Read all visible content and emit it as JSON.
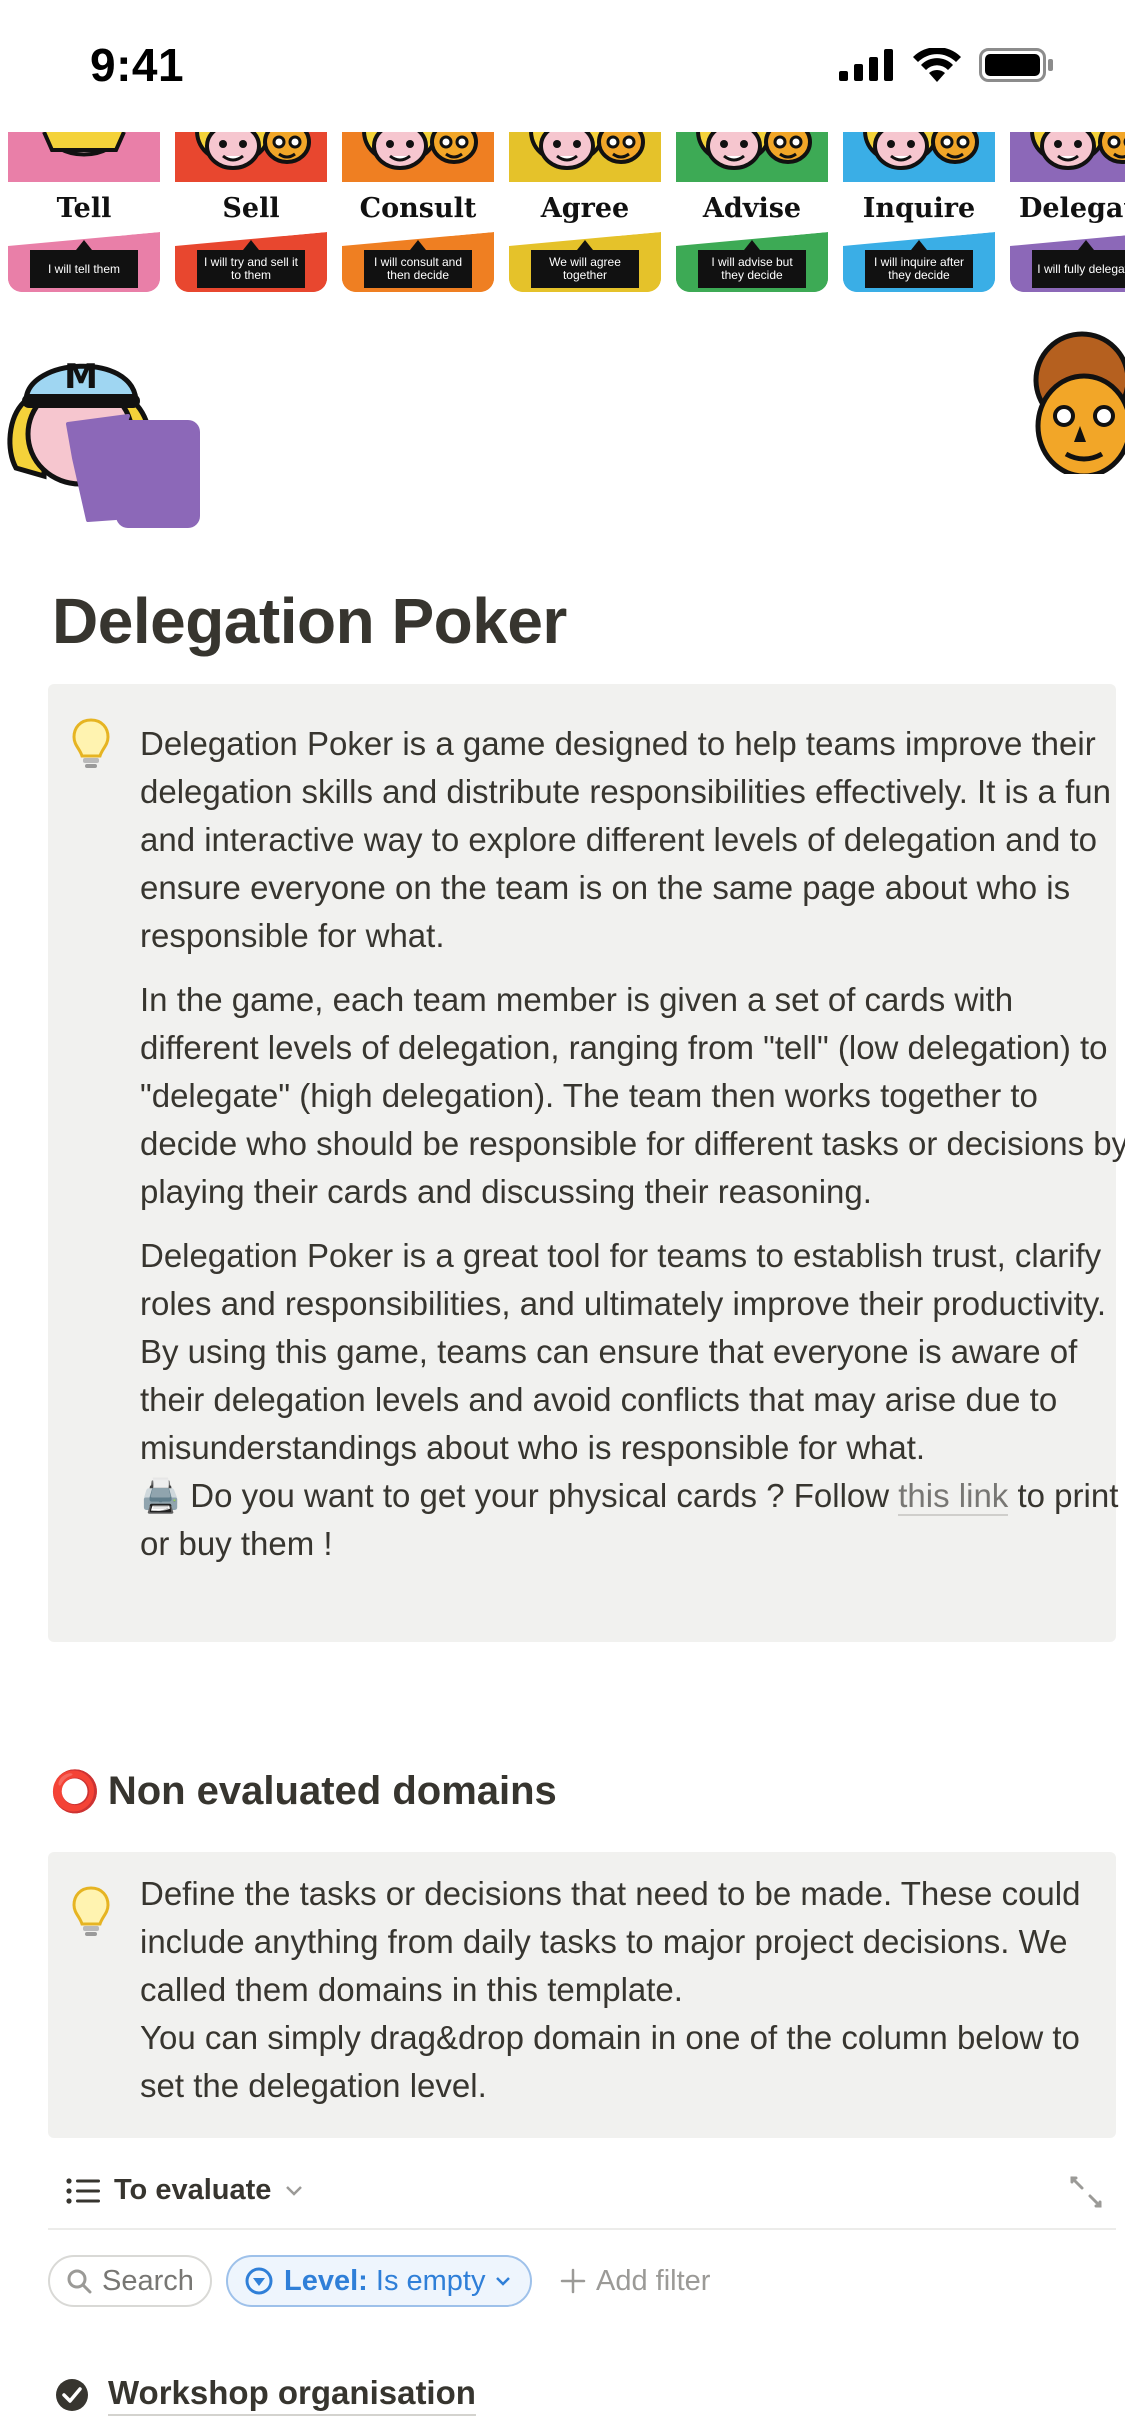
{
  "status_bar": {
    "time": "9:41"
  },
  "cover": {
    "cards": [
      {
        "title": "Tell",
        "caption": "I will tell them",
        "color": "#e97fa8"
      },
      {
        "title": "Sell",
        "caption": "I will try and sell it to them",
        "color": "#e8472f"
      },
      {
        "title": "Consult",
        "caption": "I will consult and then decide",
        "color": "#ef7f22"
      },
      {
        "title": "Agree",
        "caption": "We will agree together",
        "color": "#e5c22a"
      },
      {
        "title": "Advise",
        "caption": "I will advise but they decide",
        "color": "#3daa55"
      },
      {
        "title": "Inquire",
        "caption": "I will inquire after they decide",
        "color": "#3aaee6"
      },
      {
        "title": "Delegate",
        "caption": "I will fully delegate",
        "color": "#8c68b8"
      }
    ]
  },
  "page_icon": {
    "name": "manager-holding-card-icon",
    "badge_letter": "M",
    "card_color": "#8c68b8"
  },
  "page": {
    "title": "Delegation Poker"
  },
  "intro_callout": {
    "icon": "lightbulb-icon",
    "paragraphs": [
      "Delegation Poker is a game designed to help teams improve their delegation skills and distribute responsibilities effectively. It is a fun and interactive way to explore different levels of delegation and to ensure everyone on the team is on the same page about who is responsible for what.",
      "In the game, each team member is given a set of cards with different levels of delegation, ranging from \"tell\" (low delegation) to \"delegate\" (high delegation). The team then works together to decide who should be responsible for different tasks or decisions by playing their cards and discussing their reasoning.",
      "Delegation Poker is a great tool for teams to establish trust, clarify roles and responsibilities, and ultimately improve their productivity. By using this game, teams can ensure that everyone is aware of their delegation levels and avoid conflicts that may arise due to misunderstandings about who is responsible for what."
    ],
    "print_prefix": "🖨️ Do you want to get your physical cards ? Follow ",
    "print_link": "this link",
    "print_suffix": " to print or buy them !"
  },
  "section": {
    "emoji": "⭕",
    "title": "Non evaluated domains",
    "callout": {
      "icon": "lightbulb-icon",
      "line1": "Define the tasks or decisions that need to be made. These could include anything from daily tasks to major project decisions. We called them domains in this template.",
      "line2": "You can simply drag&drop domain in one of the column below to set the delegation level."
    }
  },
  "database": {
    "view_name": "To evaluate",
    "filters": {
      "search_placeholder": "Search",
      "level_prop": "Level:",
      "level_value": "Is empty",
      "add_filter": "Add filter"
    },
    "items": [
      {
        "label": "Workshop organisation"
      }
    ]
  },
  "colors": {
    "accent_blue": "#2f7fd8",
    "callout_bg": "#f1f1ef",
    "text": "#37352f"
  }
}
